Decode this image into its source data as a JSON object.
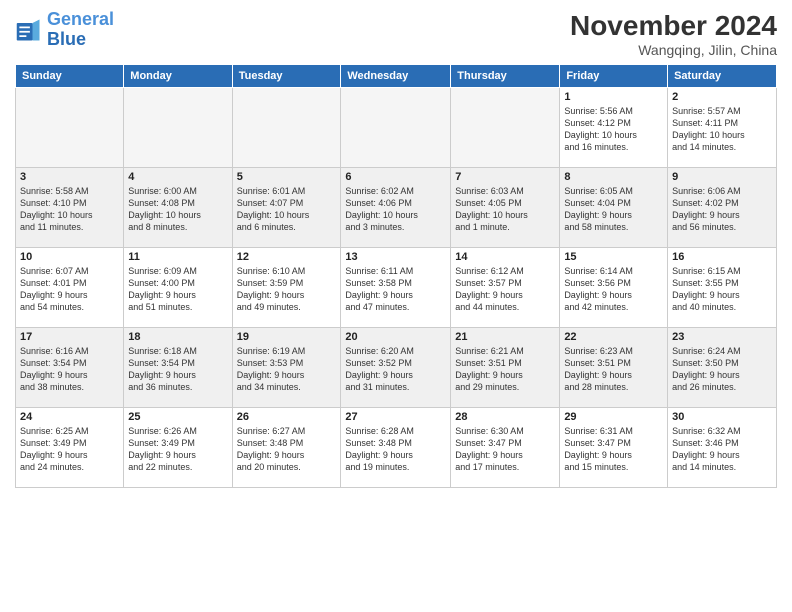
{
  "logo": {
    "line1": "General",
    "line2": "Blue"
  },
  "title": "November 2024",
  "location": "Wangqing, Jilin, China",
  "days_of_week": [
    "Sunday",
    "Monday",
    "Tuesday",
    "Wednesday",
    "Thursday",
    "Friday",
    "Saturday"
  ],
  "weeks": [
    {
      "shade": false,
      "days": [
        {
          "num": "",
          "info": ""
        },
        {
          "num": "",
          "info": ""
        },
        {
          "num": "",
          "info": ""
        },
        {
          "num": "",
          "info": ""
        },
        {
          "num": "",
          "info": ""
        },
        {
          "num": "1",
          "info": "Sunrise: 5:56 AM\nSunset: 4:12 PM\nDaylight: 10 hours\nand 16 minutes."
        },
        {
          "num": "2",
          "info": "Sunrise: 5:57 AM\nSunset: 4:11 PM\nDaylight: 10 hours\nand 14 minutes."
        }
      ]
    },
    {
      "shade": true,
      "days": [
        {
          "num": "3",
          "info": "Sunrise: 5:58 AM\nSunset: 4:10 PM\nDaylight: 10 hours\nand 11 minutes."
        },
        {
          "num": "4",
          "info": "Sunrise: 6:00 AM\nSunset: 4:08 PM\nDaylight: 10 hours\nand 8 minutes."
        },
        {
          "num": "5",
          "info": "Sunrise: 6:01 AM\nSunset: 4:07 PM\nDaylight: 10 hours\nand 6 minutes."
        },
        {
          "num": "6",
          "info": "Sunrise: 6:02 AM\nSunset: 4:06 PM\nDaylight: 10 hours\nand 3 minutes."
        },
        {
          "num": "7",
          "info": "Sunrise: 6:03 AM\nSunset: 4:05 PM\nDaylight: 10 hours\nand 1 minute."
        },
        {
          "num": "8",
          "info": "Sunrise: 6:05 AM\nSunset: 4:04 PM\nDaylight: 9 hours\nand 58 minutes."
        },
        {
          "num": "9",
          "info": "Sunrise: 6:06 AM\nSunset: 4:02 PM\nDaylight: 9 hours\nand 56 minutes."
        }
      ]
    },
    {
      "shade": false,
      "days": [
        {
          "num": "10",
          "info": "Sunrise: 6:07 AM\nSunset: 4:01 PM\nDaylight: 9 hours\nand 54 minutes."
        },
        {
          "num": "11",
          "info": "Sunrise: 6:09 AM\nSunset: 4:00 PM\nDaylight: 9 hours\nand 51 minutes."
        },
        {
          "num": "12",
          "info": "Sunrise: 6:10 AM\nSunset: 3:59 PM\nDaylight: 9 hours\nand 49 minutes."
        },
        {
          "num": "13",
          "info": "Sunrise: 6:11 AM\nSunset: 3:58 PM\nDaylight: 9 hours\nand 47 minutes."
        },
        {
          "num": "14",
          "info": "Sunrise: 6:12 AM\nSunset: 3:57 PM\nDaylight: 9 hours\nand 44 minutes."
        },
        {
          "num": "15",
          "info": "Sunrise: 6:14 AM\nSunset: 3:56 PM\nDaylight: 9 hours\nand 42 minutes."
        },
        {
          "num": "16",
          "info": "Sunrise: 6:15 AM\nSunset: 3:55 PM\nDaylight: 9 hours\nand 40 minutes."
        }
      ]
    },
    {
      "shade": true,
      "days": [
        {
          "num": "17",
          "info": "Sunrise: 6:16 AM\nSunset: 3:54 PM\nDaylight: 9 hours\nand 38 minutes."
        },
        {
          "num": "18",
          "info": "Sunrise: 6:18 AM\nSunset: 3:54 PM\nDaylight: 9 hours\nand 36 minutes."
        },
        {
          "num": "19",
          "info": "Sunrise: 6:19 AM\nSunset: 3:53 PM\nDaylight: 9 hours\nand 34 minutes."
        },
        {
          "num": "20",
          "info": "Sunrise: 6:20 AM\nSunset: 3:52 PM\nDaylight: 9 hours\nand 31 minutes."
        },
        {
          "num": "21",
          "info": "Sunrise: 6:21 AM\nSunset: 3:51 PM\nDaylight: 9 hours\nand 29 minutes."
        },
        {
          "num": "22",
          "info": "Sunrise: 6:23 AM\nSunset: 3:51 PM\nDaylight: 9 hours\nand 28 minutes."
        },
        {
          "num": "23",
          "info": "Sunrise: 6:24 AM\nSunset: 3:50 PM\nDaylight: 9 hours\nand 26 minutes."
        }
      ]
    },
    {
      "shade": false,
      "days": [
        {
          "num": "24",
          "info": "Sunrise: 6:25 AM\nSunset: 3:49 PM\nDaylight: 9 hours\nand 24 minutes."
        },
        {
          "num": "25",
          "info": "Sunrise: 6:26 AM\nSunset: 3:49 PM\nDaylight: 9 hours\nand 22 minutes."
        },
        {
          "num": "26",
          "info": "Sunrise: 6:27 AM\nSunset: 3:48 PM\nDaylight: 9 hours\nand 20 minutes."
        },
        {
          "num": "27",
          "info": "Sunrise: 6:28 AM\nSunset: 3:48 PM\nDaylight: 9 hours\nand 19 minutes."
        },
        {
          "num": "28",
          "info": "Sunrise: 6:30 AM\nSunset: 3:47 PM\nDaylight: 9 hours\nand 17 minutes."
        },
        {
          "num": "29",
          "info": "Sunrise: 6:31 AM\nSunset: 3:47 PM\nDaylight: 9 hours\nand 15 minutes."
        },
        {
          "num": "30",
          "info": "Sunrise: 6:32 AM\nSunset: 3:46 PM\nDaylight: 9 hours\nand 14 minutes."
        }
      ]
    }
  ]
}
